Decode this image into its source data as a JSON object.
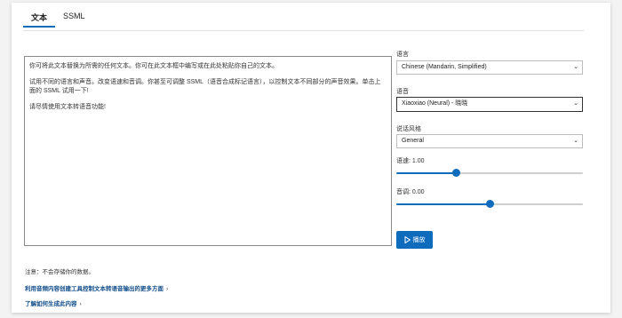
{
  "tabs": [
    {
      "label": "文本",
      "active": true
    },
    {
      "label": "SSML",
      "active": false
    }
  ],
  "editor": {
    "paragraphs": [
      "你可将此文本替换为所需的任何文本。你可在此文本框中编写或在此处粘贴你自己的文本。",
      "试用不同的语言和声音。改变语速和音调。你甚至可调整 SSML（语音合成标记语言），以控制文本不同部分的声音效果。单击上面的 SSML 试用一下!",
      "请尽情使用文本转语音功能!"
    ]
  },
  "note": "注意：不会存储你的数据。",
  "links": {
    "audio_content": "利用音频内容创建工具控制文本转语音输出的更多方面",
    "learn_more": "了解如何生成此内容"
  },
  "settings": {
    "language_label": "语言",
    "language_value": "Chinese (Mandarin, Simplified)",
    "voice_label": "语音",
    "voice_value": "Xiaoxiao (Neural) - 晓晓",
    "style_label": "说话风格",
    "style_value": "General",
    "rate_label": "语速: 1.00",
    "rate_level": 0.32,
    "pitch_label": "音调: 0.00",
    "pitch_level": 0.5
  },
  "play_label": "播放",
  "colors": {
    "accent": "#0f6cbd",
    "link": "#0f4c8a"
  },
  "icons": {
    "play": "play-icon",
    "caret": "chevron-down-icon",
    "link_chevron": "chevron-right-icon"
  }
}
